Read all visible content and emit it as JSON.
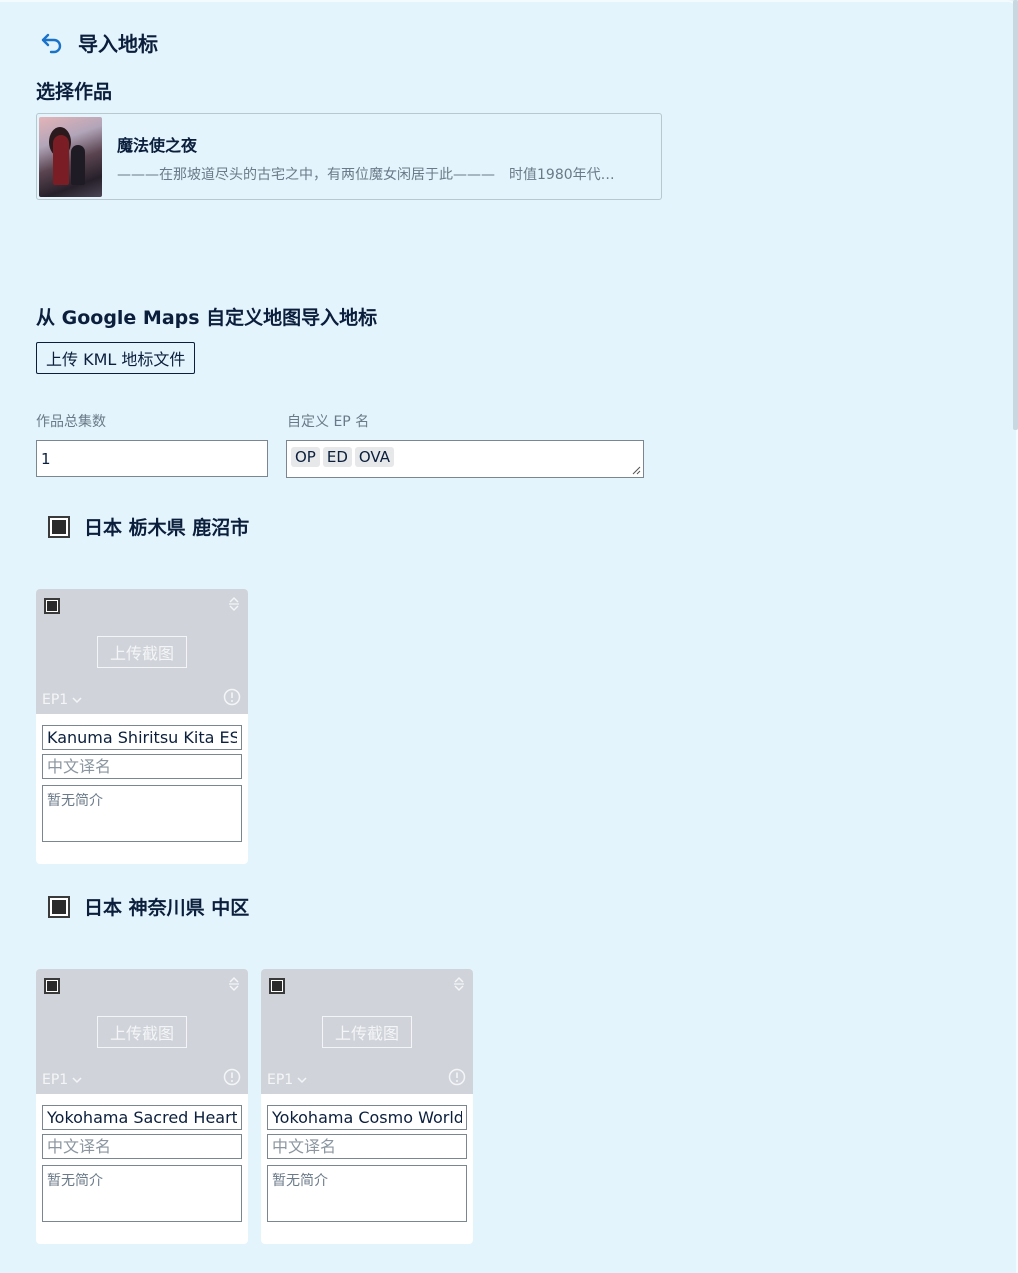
{
  "header": {
    "title": "导入地标",
    "back_icon": "undo-arrow-icon"
  },
  "select_work": {
    "section_title": "选择作品",
    "work": {
      "title": "魔法使之夜",
      "description": "———在那坡道尽头的古宅之中，有两位魔女闲居于此———　时值1980年代…"
    }
  },
  "import": {
    "section_title": "从 Google Maps 自定义地图导入地标",
    "upload_button": "上传 KML 地标文件",
    "episode_count_label": "作品总集数",
    "episode_count_value": "1",
    "custom_ep_label": "自定义 EP 名",
    "custom_ep_tags": [
      "OP",
      "ED",
      "OVA"
    ]
  },
  "groups": [
    {
      "title": "日本 栃木県 鹿沼市",
      "spots": [
        {
          "upload_label": "上传截图",
          "ep": "EP1",
          "name": "Kanuma Shiritsu Kita ES/",
          "translation_placeholder": "中文译名",
          "description_placeholder": "暂无简介"
        }
      ]
    },
    {
      "title": "日本 神奈川県 中区",
      "spots": [
        {
          "upload_label": "上传截图",
          "ep": "EP1",
          "name": "Yokohama Sacred Heart C",
          "translation_placeholder": "中文译名",
          "description_placeholder": "暂无简介"
        },
        {
          "upload_label": "上传截图",
          "ep": "EP1",
          "name": "Yokohama Cosmo World",
          "translation_placeholder": "中文译名",
          "description_placeholder": "暂无简介"
        }
      ]
    }
  ],
  "colors": {
    "background": "#e3f4fc",
    "text": "#0b1f3d",
    "muted": "#6b7a88",
    "card_image": "#d0d4da",
    "accent": "#1a73c9"
  }
}
